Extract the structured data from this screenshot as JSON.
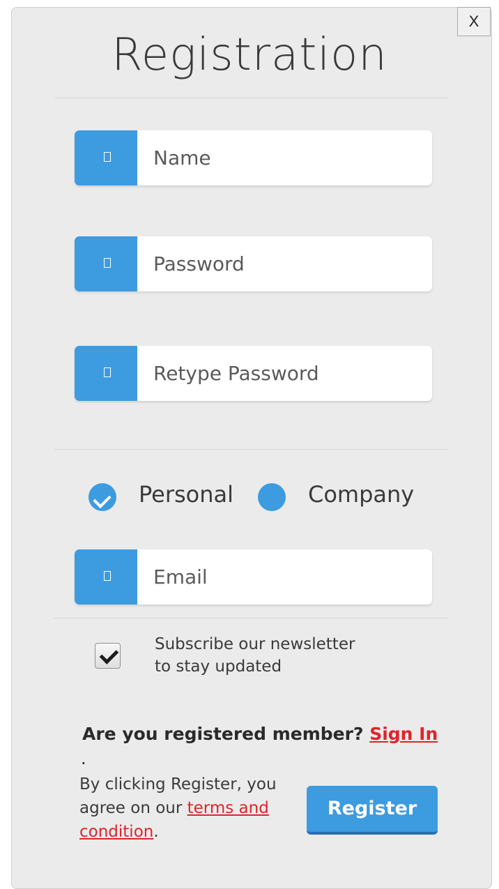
{
  "dialog": {
    "close_label": "X",
    "title": "Registration"
  },
  "fields": {
    "name": {
      "placeholder": "Name",
      "icon": "user-icon"
    },
    "password": {
      "placeholder": "Password",
      "icon": "lock-icon"
    },
    "retype_password": {
      "placeholder": "Retype Password",
      "icon": "lock-icon"
    },
    "email": {
      "placeholder": "Email",
      "icon": "mail-icon"
    }
  },
  "account_type": {
    "options": [
      {
        "label": "Personal",
        "selected": true
      },
      {
        "label": "Company",
        "selected": false
      }
    ]
  },
  "subscribe": {
    "line1": "Subscribe our newsletter",
    "line2": "to stay updated",
    "checked": true
  },
  "member": {
    "question": "Are you registered member?",
    "link": "Sign In",
    "dot": "."
  },
  "terms": {
    "prefix": "By clicking Register, you agree on our",
    "link": "terms and condition",
    "suffix": "."
  },
  "register_label": "Register",
  "colors": {
    "accent": "#3d9be0",
    "link": "#e0232b",
    "background": "#ebebeb"
  }
}
